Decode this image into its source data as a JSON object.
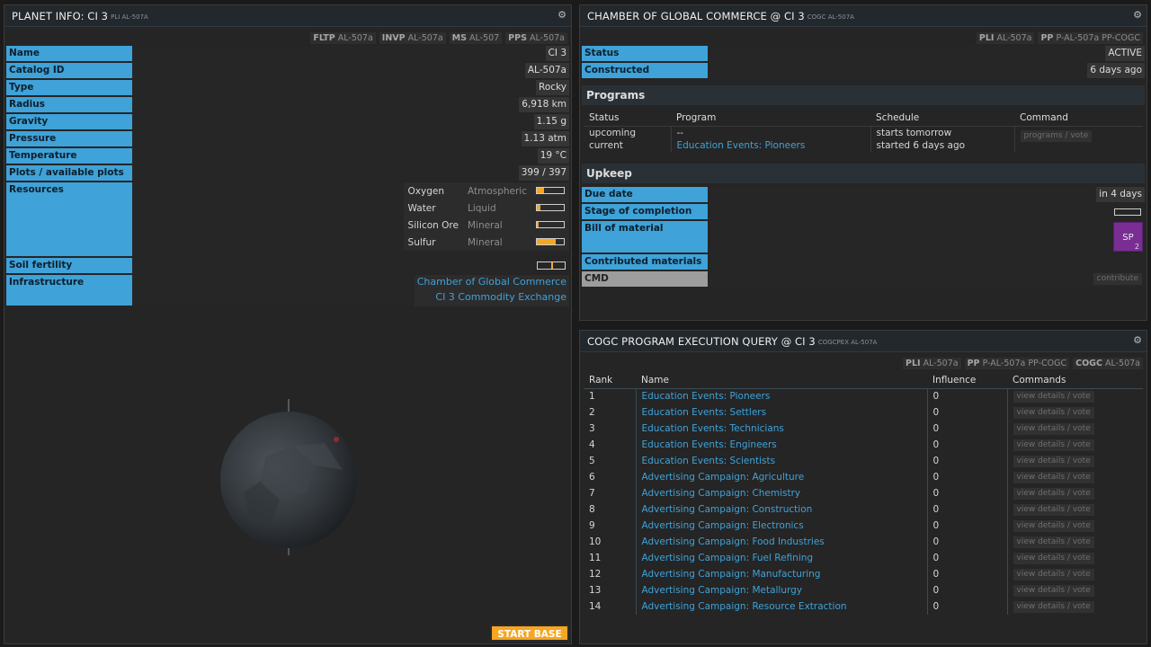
{
  "planet": {
    "title": "PLANET INFO: CI 3",
    "subtitle": "PLI AL-507A",
    "shortcuts": [
      {
        "k": "FLTP",
        "v": "AL-507a"
      },
      {
        "k": "INVP",
        "v": "AL-507a"
      },
      {
        "k": "MS",
        "v": "AL-507"
      },
      {
        "k": "PPS",
        "v": "AL-507a"
      }
    ],
    "rows": [
      {
        "label": "Name",
        "value": "CI 3"
      },
      {
        "label": "Catalog ID",
        "value": "AL-507a"
      },
      {
        "label": "Type",
        "value": "Rocky"
      },
      {
        "label": "Radius",
        "value": "6,918 km"
      },
      {
        "label": "Gravity",
        "value": "1.15 g"
      },
      {
        "label": "Pressure",
        "value": "1.13 atm"
      },
      {
        "label": "Temperature",
        "value": "19 °C"
      },
      {
        "label": "Plots / available plots",
        "value": "399 / 397"
      }
    ],
    "resources_label": "Resources",
    "resources": [
      {
        "name": "Oxygen",
        "type": "Atmospheric",
        "level": 0.25
      },
      {
        "name": "Water",
        "type": "Liquid",
        "level": 0.12
      },
      {
        "name": "Silicon Ore",
        "type": "Mineral",
        "level": 0.06
      },
      {
        "name": "Sulfur",
        "type": "Mineral",
        "level": 0.7
      }
    ],
    "soil_label": "Soil fertility",
    "soil_level": 0.5,
    "infra_label": "Infrastructure",
    "infra": [
      "Chamber of Global Commerce",
      "CI 3 Commodity Exchange"
    ],
    "start_base": "START BASE"
  },
  "cogc": {
    "title": "CHAMBER OF GLOBAL COMMERCE @ CI 3",
    "subtitle": "COGC AL-507A",
    "shortcuts": [
      {
        "k": "PLI",
        "v": "AL-507a"
      },
      {
        "k": "PP",
        "v": "P-AL-507a PP-COGC"
      }
    ],
    "status_label": "Status",
    "status": "ACTIVE",
    "constructed_label": "Constructed",
    "constructed": "6 days ago",
    "programs_title": "Programs",
    "programs_headers": [
      "Status",
      "Program",
      "Schedule",
      "Command"
    ],
    "programs": [
      {
        "status": "upcoming",
        "program": "--",
        "schedule": "starts tomorrow"
      },
      {
        "status": "current",
        "program": "Education Events: Pioneers",
        "schedule": "started 6 days ago"
      }
    ],
    "programs_cmd": "programs / vote",
    "upkeep_title": "Upkeep",
    "due_label": "Due date",
    "due": "in 4 days",
    "stage_label": "Stage of completion",
    "bom_label": "Bill of material",
    "bom_ticker": "SP",
    "bom_count": "2",
    "contrib_label": "Contributed materials",
    "cmd_label": "CMD",
    "contribute": "contribute"
  },
  "query": {
    "title": "COGC PROGRAM EXECUTION QUERY @ CI 3",
    "subtitle": "COGCPEX AL-507A",
    "shortcuts": [
      {
        "k": "PLI",
        "v": "AL-507a"
      },
      {
        "k": "PP",
        "v": "P-AL-507a PP-COGC"
      },
      {
        "k": "COGC",
        "v": "AL-507a"
      }
    ],
    "headers": [
      "Rank",
      "Name",
      "Influence",
      "Commands"
    ],
    "btn": "view details / vote",
    "rows": [
      {
        "rank": "1",
        "name": "Education Events: Pioneers",
        "influence": "0"
      },
      {
        "rank": "2",
        "name": "Education Events: Settlers",
        "influence": "0"
      },
      {
        "rank": "3",
        "name": "Education Events: Technicians",
        "influence": "0"
      },
      {
        "rank": "4",
        "name": "Education Events: Engineers",
        "influence": "0"
      },
      {
        "rank": "5",
        "name": "Education Events: Scientists",
        "influence": "0"
      },
      {
        "rank": "6",
        "name": "Advertising Campaign: Agriculture",
        "influence": "0"
      },
      {
        "rank": "7",
        "name": "Advertising Campaign: Chemistry",
        "influence": "0"
      },
      {
        "rank": "8",
        "name": "Advertising Campaign: Construction",
        "influence": "0"
      },
      {
        "rank": "9",
        "name": "Advertising Campaign: Electronics",
        "influence": "0"
      },
      {
        "rank": "10",
        "name": "Advertising Campaign: Food Industries",
        "influence": "0"
      },
      {
        "rank": "11",
        "name": "Advertising Campaign: Fuel Refining",
        "influence": "0"
      },
      {
        "rank": "12",
        "name": "Advertising Campaign: Manufacturing",
        "influence": "0"
      },
      {
        "rank": "13",
        "name": "Advertising Campaign: Metallurgy",
        "influence": "0"
      },
      {
        "rank": "14",
        "name": "Advertising Campaign: Resource Extraction",
        "influence": "0"
      }
    ]
  },
  "colors": {
    "accent": "#3fa2d9",
    "warn": "#f5a623",
    "material": "#7a2e93"
  }
}
